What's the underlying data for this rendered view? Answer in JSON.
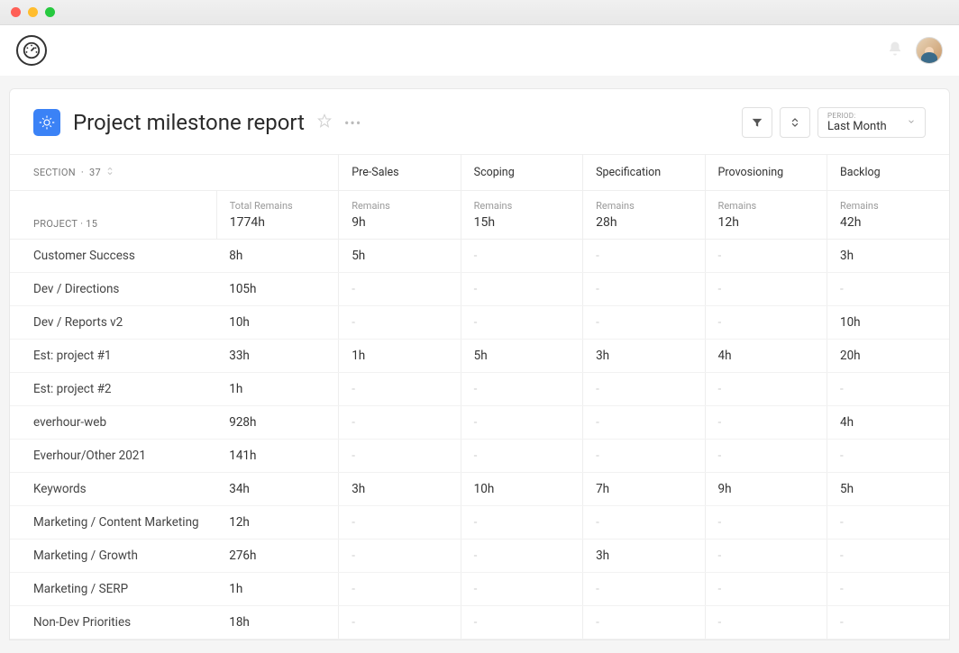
{
  "header": {
    "title": "Project milestone report",
    "period_label": "PERIOD:",
    "period_value": "Last Month"
  },
  "table": {
    "section_label": "SECTION",
    "section_count": "37",
    "project_label": "PROJECT",
    "project_count": "15",
    "total_remains_label": "Total Remains",
    "remains_label": "Remains",
    "columns": [
      {
        "name": "Pre-Sales",
        "total": "9h"
      },
      {
        "name": "Scoping",
        "total": "15h"
      },
      {
        "name": "Specification",
        "total": "28h"
      },
      {
        "name": "Provosioning",
        "total": "12h"
      },
      {
        "name": "Backlog",
        "total": "42h"
      }
    ],
    "grand_total": "1774h",
    "rows": [
      {
        "name": "Customer Success",
        "total": "8h",
        "cells": [
          "5h",
          "-",
          "-",
          "-",
          "3h"
        ]
      },
      {
        "name": "Dev / Directions",
        "total": "105h",
        "cells": [
          "-",
          "-",
          "-",
          "-",
          "-"
        ]
      },
      {
        "name": "Dev / Reports v2",
        "total": "10h",
        "cells": [
          "-",
          "-",
          "-",
          "-",
          "10h"
        ]
      },
      {
        "name": "Est: project #1",
        "total": "33h",
        "cells": [
          "1h",
          "5h",
          "3h",
          "4h",
          "20h"
        ]
      },
      {
        "name": "Est: project #2",
        "total": "1h",
        "cells": [
          "-",
          "-",
          "-",
          "-",
          "-"
        ]
      },
      {
        "name": "everhour-web",
        "total": "928h",
        "cells": [
          "-",
          "-",
          "-",
          "-",
          "4h"
        ]
      },
      {
        "name": "Everhour/Other 2021",
        "total": "141h",
        "cells": [
          "-",
          "-",
          "-",
          "-",
          "-"
        ]
      },
      {
        "name": "Keywords",
        "total": "34h",
        "cells": [
          "3h",
          "10h",
          "7h",
          "9h",
          "5h"
        ]
      },
      {
        "name": "Marketing / Content Marketing",
        "total": "12h",
        "cells": [
          "-",
          "-",
          "-",
          "-",
          "-"
        ]
      },
      {
        "name": "Marketing / Growth",
        "total": "276h",
        "cells": [
          "-",
          "-",
          "3h",
          "-",
          "-"
        ]
      },
      {
        "name": "Marketing / SERP",
        "total": "1h",
        "cells": [
          "-",
          "-",
          "-",
          "-",
          "-"
        ]
      },
      {
        "name": "Non-Dev Priorities",
        "total": "18h",
        "cells": [
          "-",
          "-",
          "-",
          "-",
          "-"
        ]
      }
    ]
  }
}
